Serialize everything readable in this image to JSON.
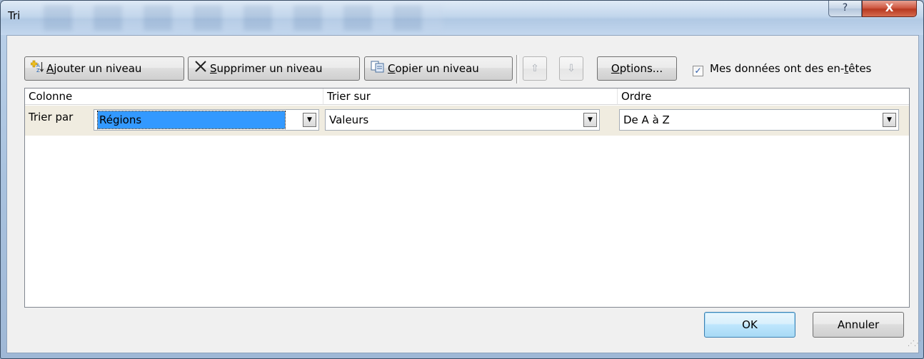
{
  "window": {
    "title": "Tri",
    "help_label": "?",
    "close_label": "X"
  },
  "toolbar": {
    "add_level": {
      "mnemonic": "A",
      "rest": "jouter un niveau"
    },
    "delete_level": {
      "mnemonic": "S",
      "rest": "upprimer un niveau"
    },
    "copy_level": {
      "mnemonic": "C",
      "rest": "opier un niveau"
    },
    "move_up_glyph": "⇧",
    "move_down_glyph": "⇩",
    "options": {
      "mnemonic": "O",
      "rest": "ptions..."
    },
    "headers_checkbox": {
      "checked": true,
      "pre": "Mes données ont des en-",
      "mnemonic": "t",
      "post": "êtes"
    }
  },
  "grid": {
    "columns": [
      "Colonne",
      "Trier sur",
      "Ordre"
    ],
    "rows": [
      {
        "label": "Trier par",
        "column": "Régions",
        "sort_on": "Valeurs",
        "order": "De A à Z"
      }
    ]
  },
  "footer": {
    "ok": "OK",
    "cancel": "Annuler"
  },
  "colors": {
    "selection": "#3399ff",
    "row_background": "#f0ece0",
    "client_background": "#f0f0f0",
    "close_button": "#c94a33"
  }
}
